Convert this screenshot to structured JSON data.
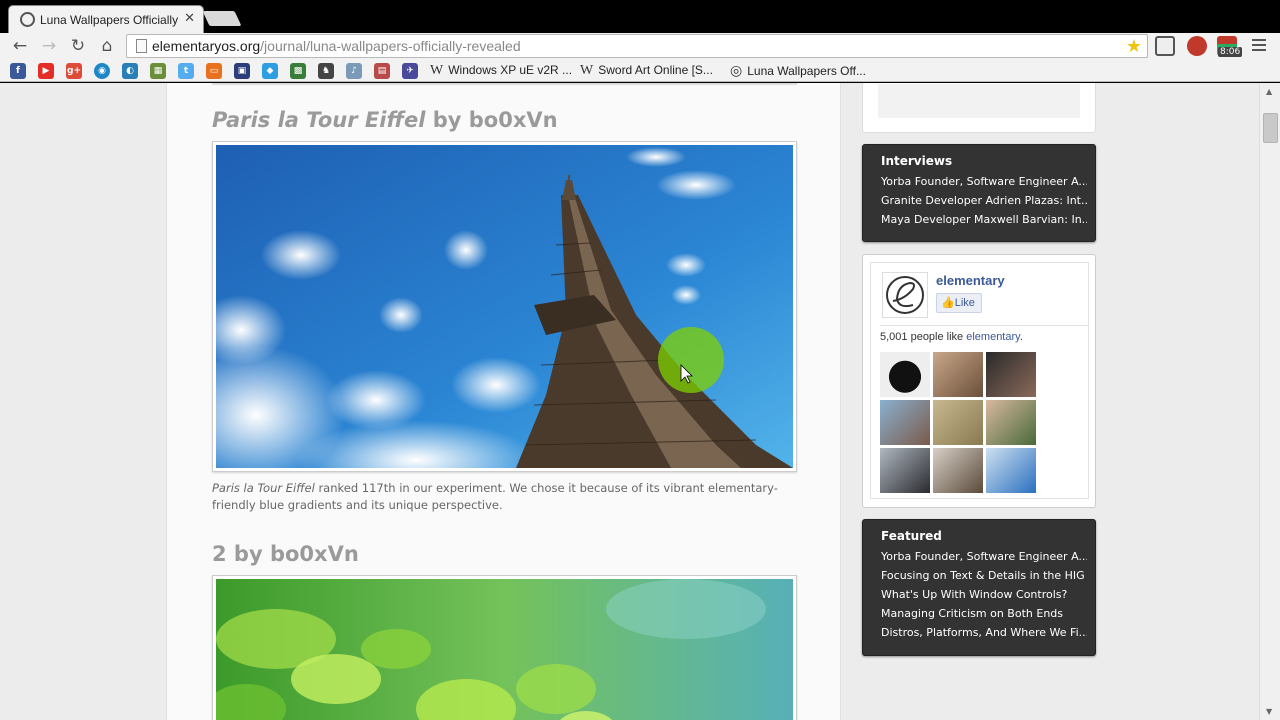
{
  "browser": {
    "tab_title": "Luna Wallpapers Officially",
    "url_domain": "elementaryos.org",
    "url_path": "/journal/luna-wallpapers-officially-revealed",
    "clock_badge": "8:06",
    "bookmarks": [
      {
        "label": "Windows XP uE v2R ..."
      },
      {
        "label": "Sword Art Online [S..."
      },
      {
        "label": "Luna Wallpapers Off..."
      }
    ]
  },
  "post": {
    "section1": {
      "title_italic": "Paris la Tour Eiffel",
      "title_rest": " by bo0xVn",
      "caption_italic": "Paris la Tour Eiffel",
      "caption_rest": " ranked 117th in our experiment. We chose it because of its vibrant elementary-friendly blue gradients and its unique perspective."
    },
    "section2": {
      "title": "2 by bo0xVn"
    }
  },
  "sidebar": {
    "interviews": {
      "heading": "Interviews",
      "items": [
        "Yorba Founder, Software Engineer A...",
        "Granite Developer Adrien Plazas: Int...",
        "Maya Developer Maxwell Barvian: In..."
      ]
    },
    "facebook": {
      "page_name": "elementary",
      "like_label": "Like",
      "count_text": "5,001 people like ",
      "count_link": "elementary",
      "count_end": "."
    },
    "featured": {
      "heading": "Featured",
      "items": [
        "Yorba Founder, Software Engineer A...",
        "Focusing on Text & Details in the HIG",
        "What's Up With Window Controls?",
        "Managing Criticism on Both Ends",
        "Distros, Platforms, And Where We Fi..."
      ]
    }
  }
}
